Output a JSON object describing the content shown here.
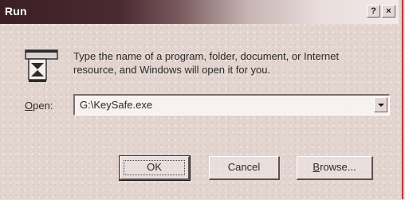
{
  "window": {
    "title": "Run",
    "help_label": "?",
    "close_label": "×"
  },
  "dialog": {
    "icon": "run-icon",
    "description": "Type the name of a program, folder, document, or Internet resource, and Windows will open it for you.",
    "open_label_accel": "O",
    "open_label_rest": "pen:",
    "open_value": "G:\\KeySafe.exe"
  },
  "buttons": {
    "ok": "OK",
    "cancel": "Cancel",
    "browse_accel": "B",
    "browse_rest": "rowse..."
  },
  "colors": {
    "titlebar_dark": "#3a1f26",
    "dialog_bg": "#e2d4cf",
    "edge_accent": "#b23a3a"
  }
}
